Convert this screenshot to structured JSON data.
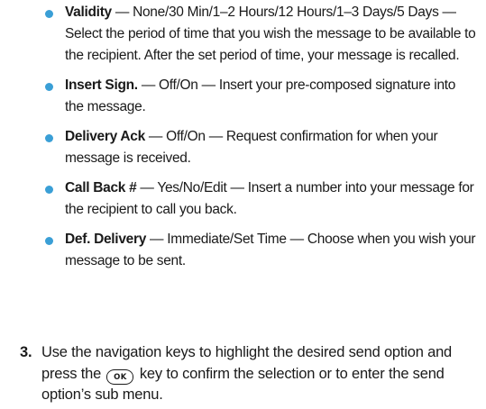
{
  "bullets": [
    {
      "term": "Validity",
      "sep": " — ",
      "options": "None/30 Min/1–2 Hours/12 Hours/1–3 Days/5 Days",
      "sep2": " — ",
      "description": "Select the period of time that you wish the message to be available to the recipient. After the set period of time, your message is recalled."
    },
    {
      "term": "Insert Sign.",
      "sep": " — ",
      "options": "Off/On",
      "sep2": " — ",
      "description": "Insert your pre-composed signature into the message."
    },
    {
      "term": "Delivery Ack",
      "sep": " — ",
      "options": "Off/On",
      "sep2": " — ",
      "description": "Request confirmation for when your message is received."
    },
    {
      "term": "Call Back #",
      "sep": " — ",
      "options": "Yes/No/Edit",
      "sep2": " — ",
      "description": "Insert a number into your message for the recipient to call you back."
    },
    {
      "term": "Def. Delivery",
      "sep": " — ",
      "options": "Immediate/Set Time",
      "sep2": " — ",
      "description": "Choose when you wish your message to be sent."
    }
  ],
  "step": {
    "number": "3.",
    "text_before": "Use the navigation keys to highlight the desired send option and press the",
    "key_label": "OK",
    "text_after": "key to confirm the selection or to enter the send option’s sub menu."
  },
  "colors": {
    "bullet": "#3a9fd6",
    "text": "#1a1a1a"
  },
  "icons": {
    "bullet": "filled-circle",
    "ok_key": "rounded-key-outline"
  }
}
